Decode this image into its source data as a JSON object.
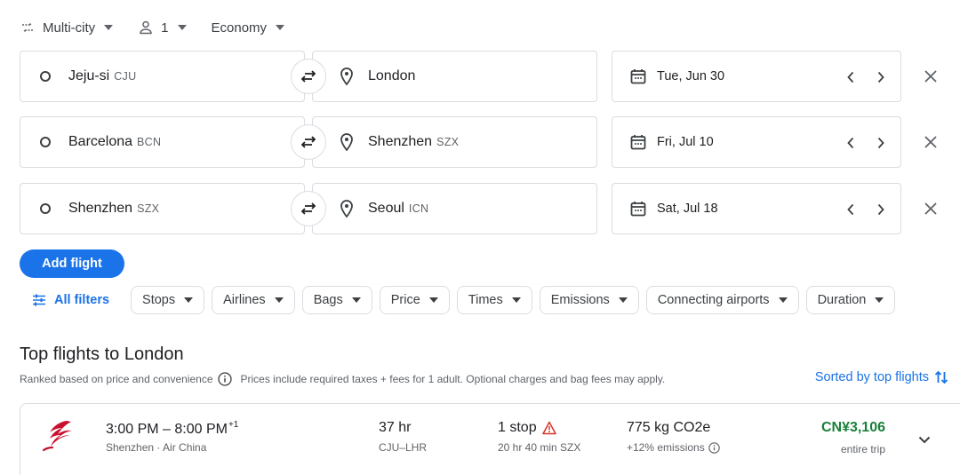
{
  "trip": {
    "type_label": "Multi-city",
    "passengers": "1",
    "cabin": "Economy"
  },
  "legs": [
    {
      "origin_city": "Jeju-si",
      "origin_code": "CJU",
      "dest_city": "London",
      "dest_code": "",
      "date": "Tue, Jun 30"
    },
    {
      "origin_city": "Barcelona",
      "origin_code": "BCN",
      "dest_city": "Shenzhen",
      "dest_code": "SZX",
      "date": "Fri, Jul 10"
    },
    {
      "origin_city": "Shenzhen",
      "origin_code": "SZX",
      "dest_city": "Seoul",
      "dest_code": "ICN",
      "date": "Sat, Jul 18"
    }
  ],
  "add_flight_label": "Add flight",
  "filters": {
    "all_filters_label": "All filters",
    "chips": [
      "Stops",
      "Airlines",
      "Bags",
      "Price",
      "Times",
      "Emissions",
      "Connecting airports",
      "Duration"
    ]
  },
  "results": {
    "title": "Top flights to London",
    "ranked_text": "Ranked based on price and convenience",
    "prices_note": "Prices include required taxes + fees for 1 adult. Optional charges and bag fees may apply.",
    "sort_label": "Sorted by top flights"
  },
  "flights": [
    {
      "times": "3:00 PM – 8:00 PM",
      "day_offset": "+1",
      "via": "Shenzhen · Air China",
      "duration": "37 hr",
      "route": "CJU–LHR",
      "stops": "1 stop",
      "layover": "20 hr 40 min SZX",
      "co2": "775 kg CO2e",
      "emissions": "+12% emissions",
      "price": "CN¥3,106",
      "price_type": "entire trip"
    }
  ],
  "colors": {
    "accent": "#1a73e8",
    "price": "#188038",
    "warning": "#d93025",
    "airline_logo": "#c8102e",
    "border": "#dadce0"
  },
  "icons": {
    "trip_type": "swap-horiz-icon",
    "passenger": "person-icon",
    "origin": "circle-icon",
    "destination": "location-pin-icon",
    "swap": "swap-arrows-icon",
    "date": "calendar-icon",
    "remove": "close-icon",
    "filters": "tune-icon",
    "info": "info-icon",
    "sort": "sort-arrows-icon",
    "warning": "warning-icon",
    "expand": "chevron-down-icon"
  }
}
